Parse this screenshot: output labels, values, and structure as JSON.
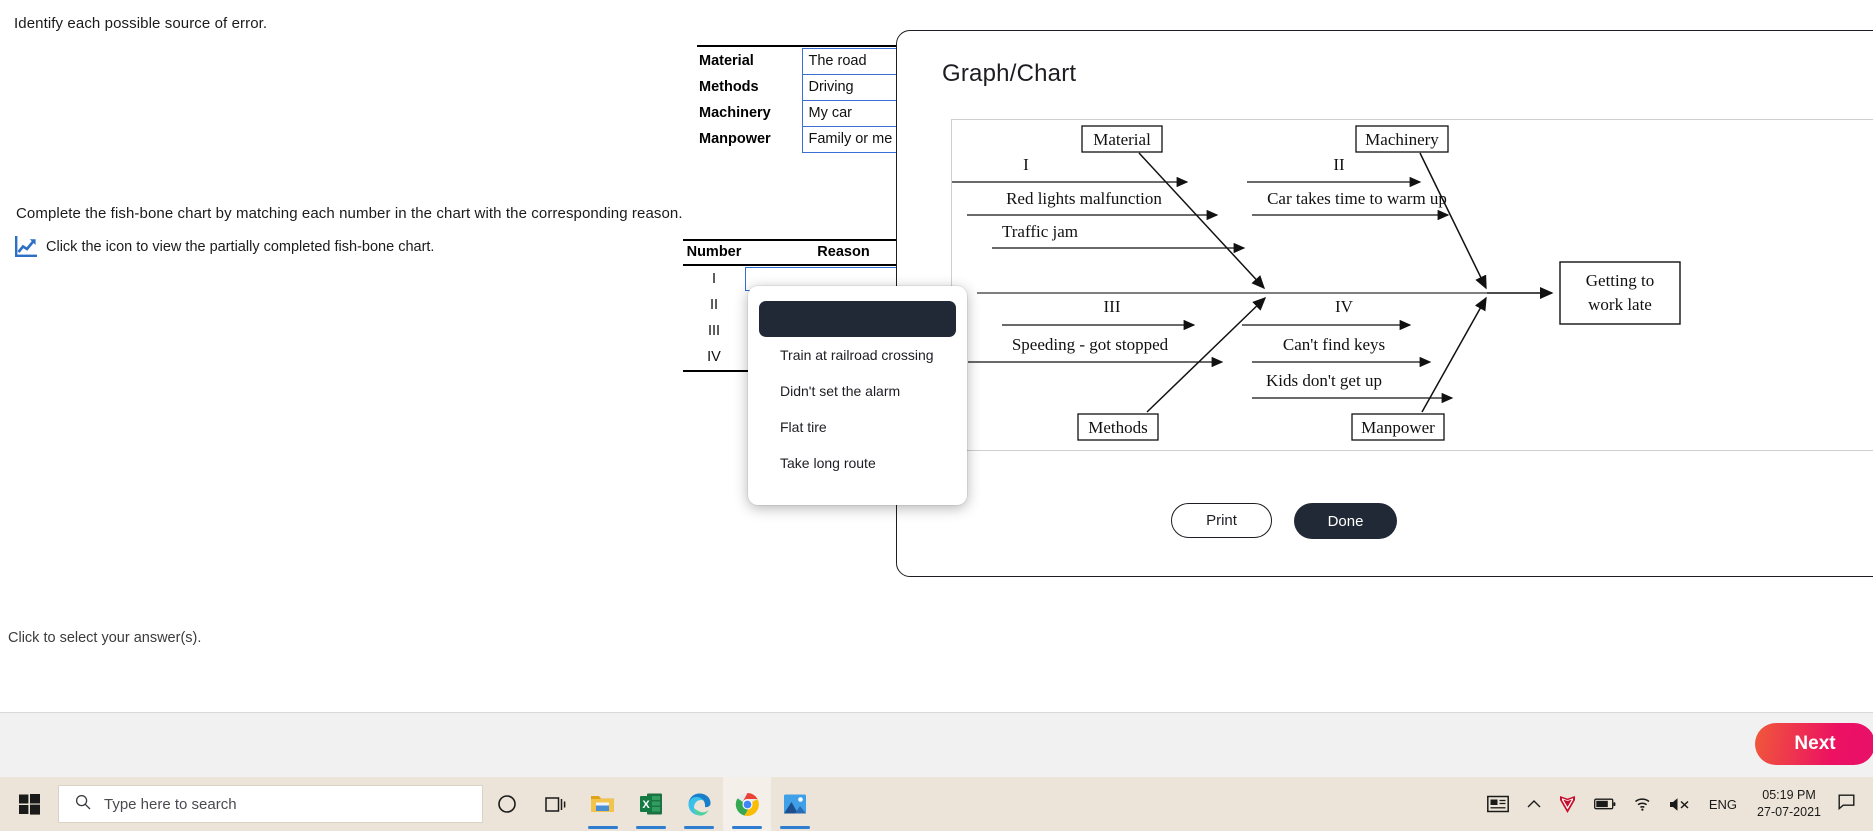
{
  "question": {
    "prompt": "Identify each possible source of error.",
    "instruction": "Complete the fish-bone chart by matching each number in the chart with the corresponding reason.",
    "icon_hint": "Click the icon to view the partially completed fish-bone chart.",
    "icon_name": "chart-icon",
    "bottom_hint": "Click to select your answer(s)."
  },
  "category_table": {
    "rows": [
      {
        "key": "Material",
        "value": "The road"
      },
      {
        "key": "Methods",
        "value": "Driving"
      },
      {
        "key": "Machinery",
        "value": "My car"
      },
      {
        "key": "Manpower",
        "value": "Family or me"
      }
    ]
  },
  "answer_table": {
    "headers": {
      "number": "Number",
      "reason": "Reason"
    },
    "rows": [
      {
        "number": "I",
        "reason": ""
      },
      {
        "number": "II",
        "reason": ""
      },
      {
        "number": "III",
        "reason": ""
      },
      {
        "number": "IV",
        "reason": ""
      }
    ]
  },
  "dropdown": {
    "selected": "",
    "options": [
      "Train at railroad crossing",
      "Didn't set the alarm",
      "Flat tire",
      "Take long route"
    ]
  },
  "modal": {
    "title": "Graph/Chart",
    "print_label": "Print",
    "done_label": "Done"
  },
  "fishbone": {
    "effect": {
      "line1": "Getting to",
      "line2": "work late"
    },
    "categories": [
      {
        "label": "Material",
        "position": "top-left"
      },
      {
        "label": "Machinery",
        "position": "top-right"
      },
      {
        "label": "Methods",
        "position": "bottom-left"
      },
      {
        "label": "Manpower",
        "position": "bottom-right"
      }
    ],
    "causes": {
      "material": [
        "I",
        "Red lights malfunction",
        "Traffic jam"
      ],
      "machinery": [
        "II",
        "Car takes time to warm up"
      ],
      "methods": [
        "III",
        "Speeding - got stopped"
      ],
      "manpower": [
        "IV",
        "Can't find keys",
        "Kids don't get up"
      ]
    }
  },
  "footer": {
    "next_label": "Next"
  },
  "taskbar": {
    "start_icon": "windows-logo-icon",
    "search_placeholder": "Type here to search",
    "search_icon": "search-icon",
    "cortana_icon": "cortana-circle-icon",
    "task_view_icon": "task-view-icon",
    "apps": [
      {
        "name": "file-explorer-icon",
        "active": false
      },
      {
        "name": "excel-icon",
        "active": false
      },
      {
        "name": "microsoft-edge-icon",
        "active": false
      },
      {
        "name": "google-chrome-icon",
        "active": true
      },
      {
        "name": "photos-icon",
        "active": false
      }
    ],
    "tray": {
      "news_icon": "news-and-interests-icon",
      "chevron_icon": "show-hidden-icons-chevron-up",
      "security_icon": "mcafee-shield-icon",
      "battery_icon": "battery-icon",
      "network_icon": "wifi-icon",
      "volume_icon": "volume-muted-icon",
      "language": "ENG",
      "time": "05:19 PM",
      "date": "27-07-2021",
      "notification_icon": "action-center-icon"
    }
  },
  "colors": {
    "accent_pink": "#ec1162",
    "dark_button": "#222936",
    "input_border_blue": "#2f6fd0",
    "taskbar_bg": "#ece4d8"
  }
}
